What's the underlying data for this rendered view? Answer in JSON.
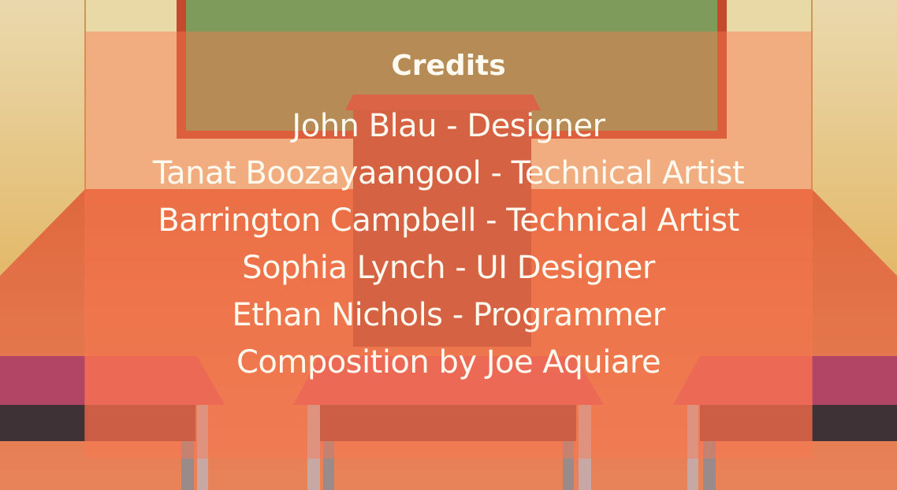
{
  "screen": "credits",
  "title": "Credits",
  "credits": [
    "John Blau - Designer",
    "Tanat Boozayaangool - Technical Artist",
    "Barrington Campbell - Technical Artist",
    "Sophia Lynch - UI Designer",
    "Ethan Nichols - Programmer",
    "Composition by Joe Aquiare"
  ],
  "colors": {
    "overlay": "#f07c56",
    "text": "#fffaf0",
    "chalkboard": "#7e9b5c",
    "chalkboard_frame": "#c34a2c",
    "wall": "#e7d8a8",
    "floor": "#e47b4f",
    "desk_top": "#df5e59",
    "stripe_magenta": "#b24466"
  }
}
